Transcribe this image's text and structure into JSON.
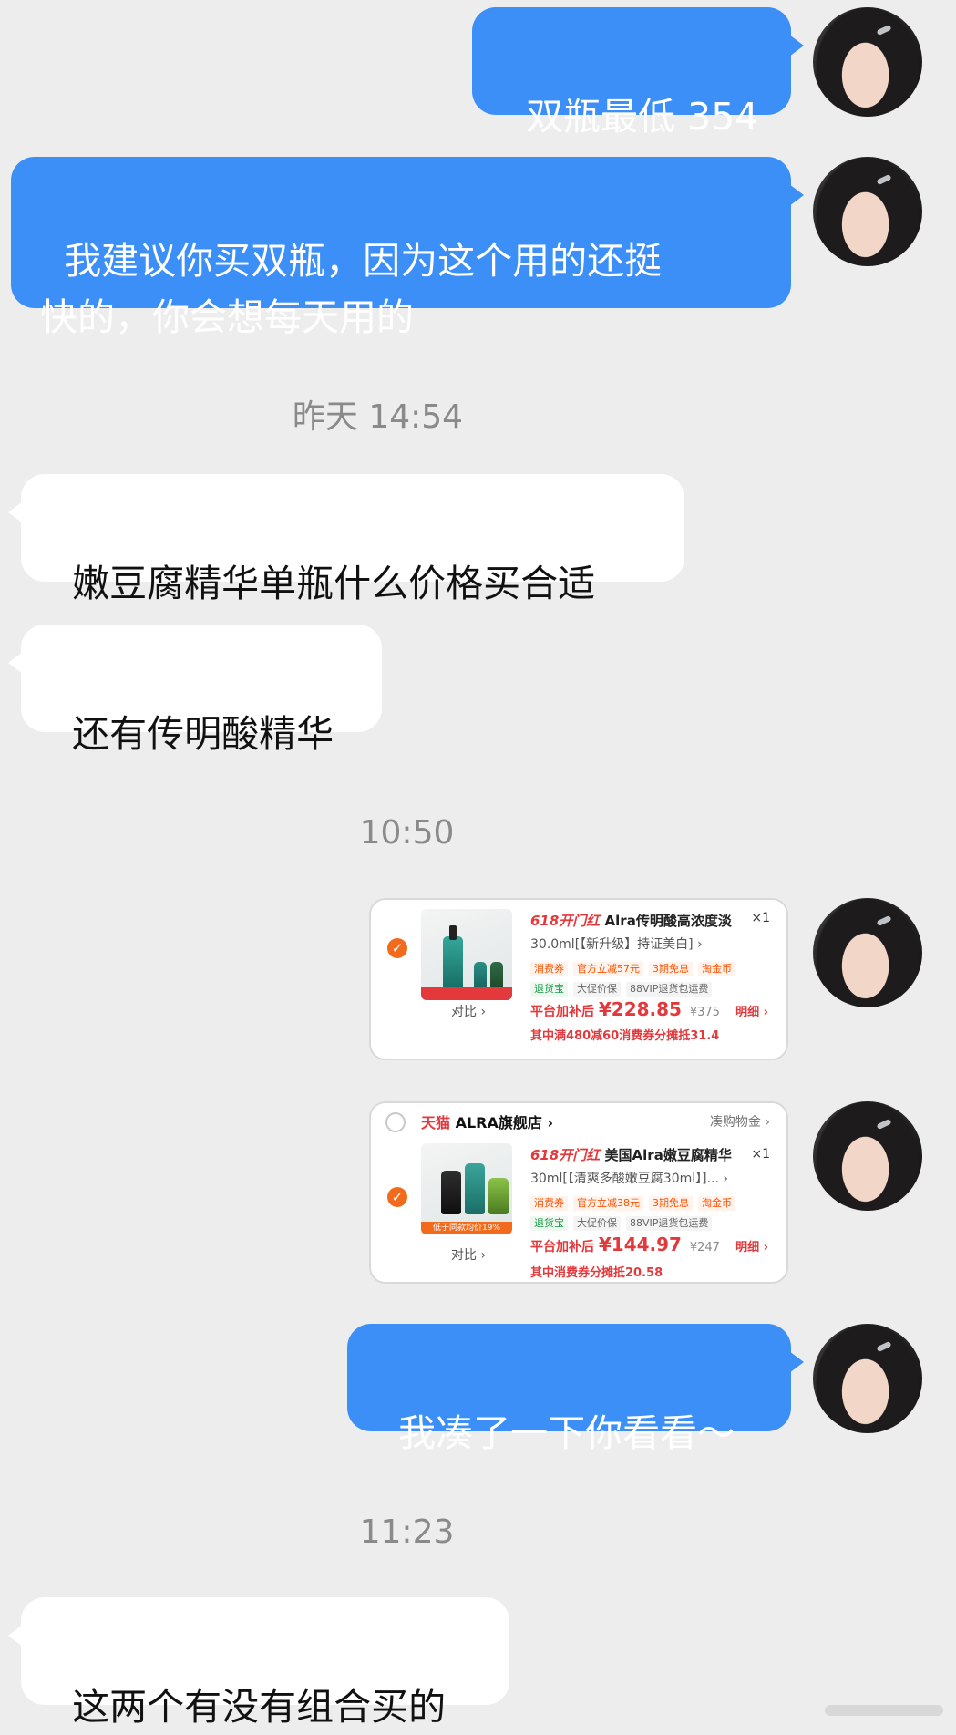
{
  "messages": {
    "m1": "双瓶最低 354",
    "m2": "我建议你买双瓶，因为这个用的还挺\n快的，你会想每天用的",
    "m3": "嫩豆腐精华单瓶什么价格买合适",
    "m4": "还有传明酸精华",
    "m5": "我凑了一下你看看～",
    "m6": "这两个有没有组合买的"
  },
  "timestamps": {
    "t1": "昨天 14:54",
    "t2": "10:50",
    "t3": "11:23"
  },
  "card1": {
    "label_618": "618开门红",
    "title": "Alra传明酸高浓度淡",
    "qty": "×1",
    "subtitle": "30.0ml[【新升级】持证美白]",
    "tags_row1": [
      "消费券",
      "官方立减57元",
      "3期免息",
      "淘金币"
    ],
    "tags_row2": [
      "退货宝",
      "大促价保",
      "88VIP退货包运费"
    ],
    "compare": "对比",
    "price_prefix": "平台加补后",
    "price": "¥228.85",
    "orig_price": "¥375",
    "detail": "明细",
    "promo": "其中满480减60消费券分摊抵31.4"
  },
  "card2": {
    "store_brand": "天猫",
    "store_name": "ALRA旗舰店",
    "store_right": "凑购物金",
    "label_618": "618开门红",
    "title": "美国Alra嫩豆腐精华",
    "qty": "×1",
    "subtitle": "30ml[【清爽多酸嫩豆腐30ml】]...",
    "tags_row1": [
      "消费券",
      "官方立减38元",
      "3期免息",
      "淘金币"
    ],
    "tags_row2": [
      "退货宝",
      "大促价保",
      "88VIP退货包运费"
    ],
    "thumb_strip": "低于同款均价19%",
    "compare": "对比",
    "price_prefix": "平台加补后",
    "price": "¥144.97",
    "orig_price": "¥247",
    "detail": "明细",
    "promo": "其中消费券分摊抵20.58"
  }
}
